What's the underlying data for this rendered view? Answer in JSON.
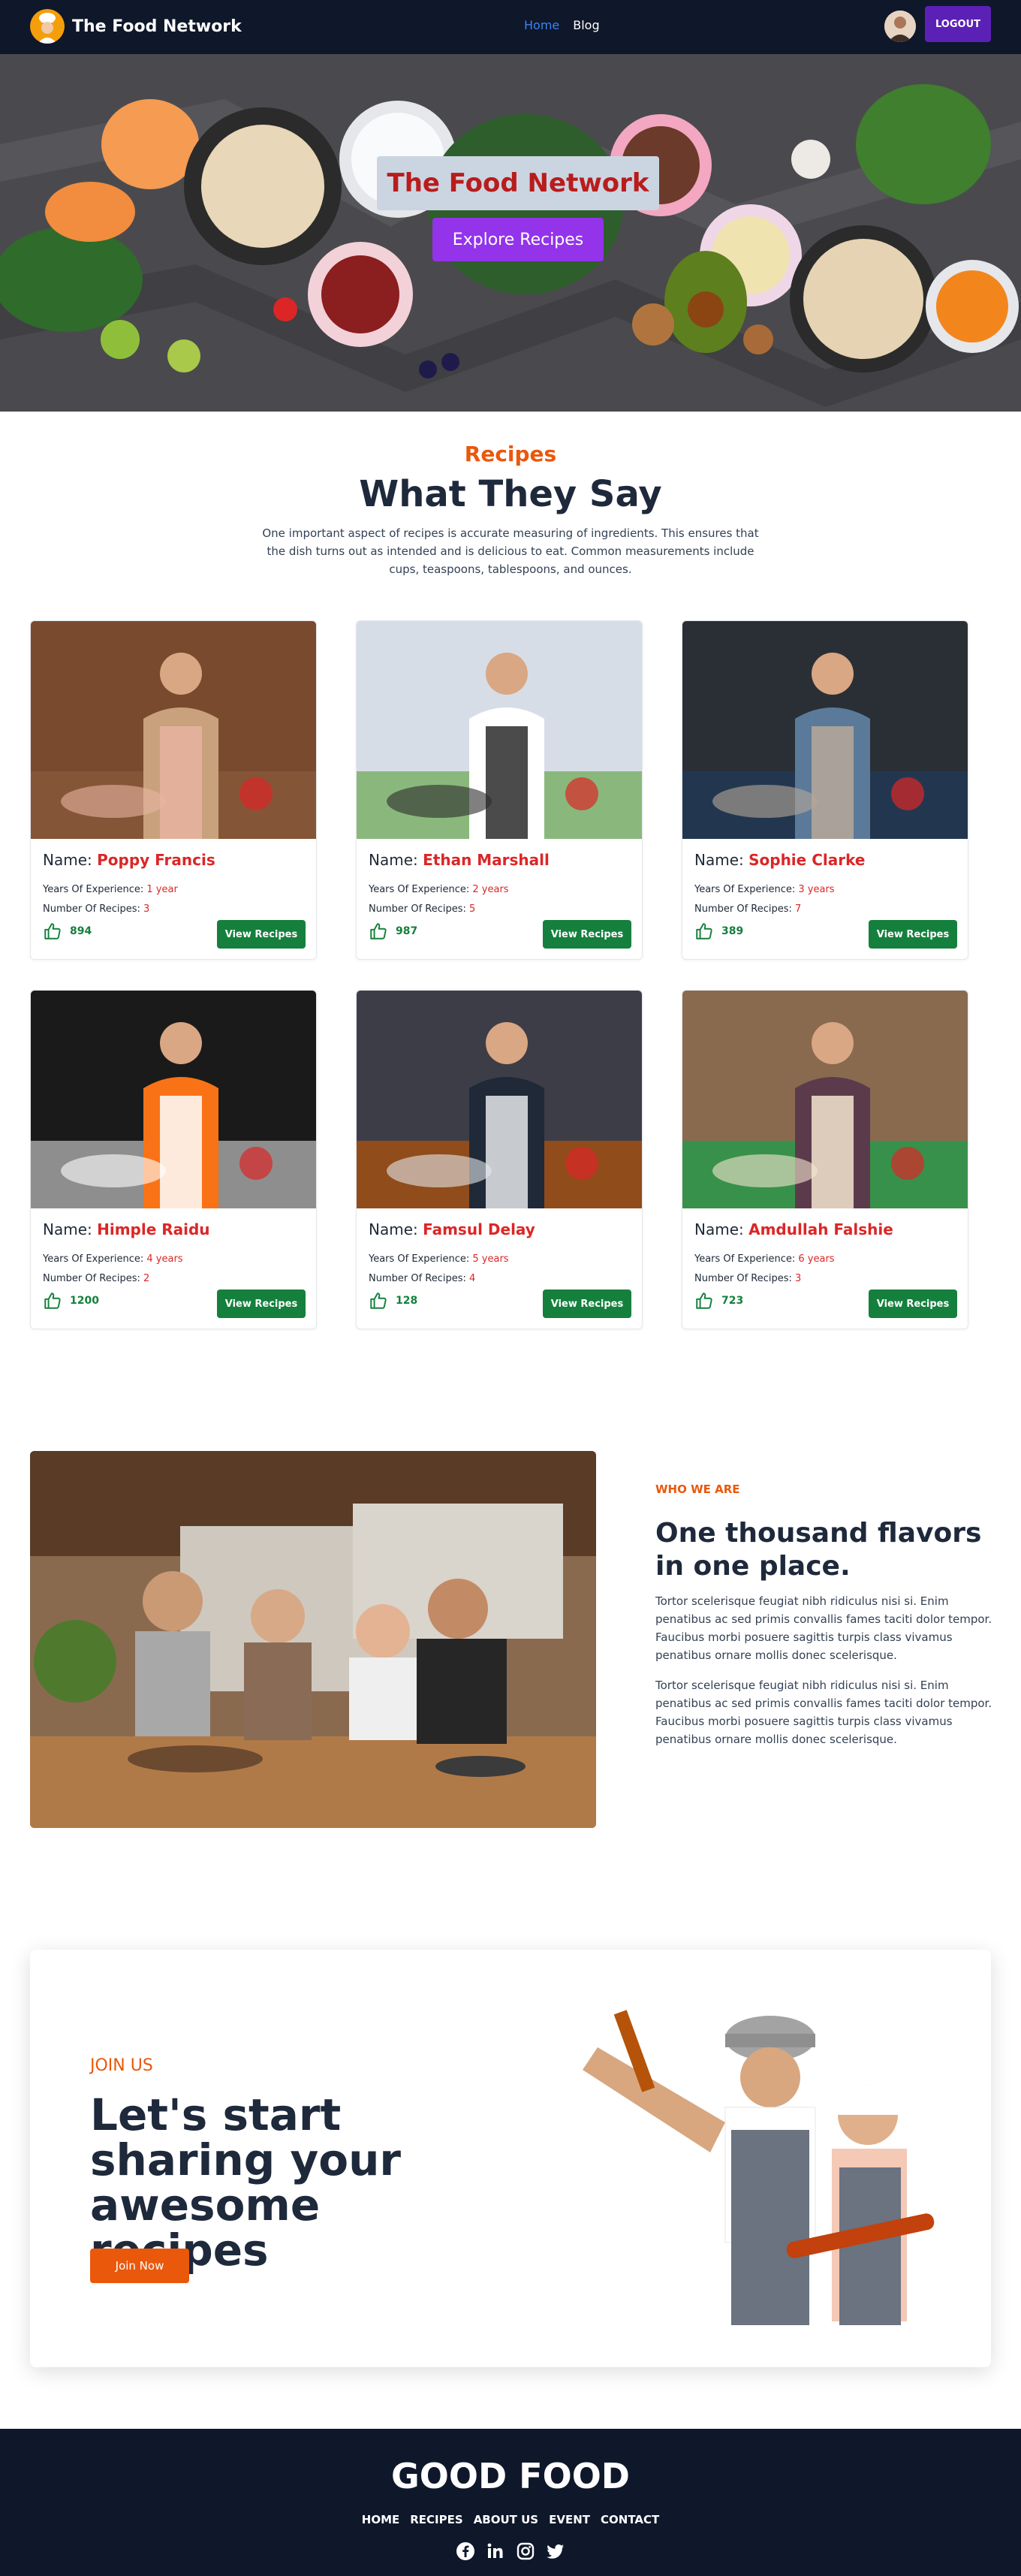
{
  "nav": {
    "brand": "The Food Network",
    "links": [
      {
        "label": "Home",
        "active": true
      },
      {
        "label": "Blog",
        "active": false
      }
    ],
    "logout_label": "LOGOUT"
  },
  "hero": {
    "title": "The Food Network",
    "button_label": "Explore Recipes"
  },
  "recipes_section": {
    "eyebrow": "Recipes",
    "title": "What They Say",
    "description": "One important aspect of recipes is accurate measuring of ingredients. This ensures that the dish turns out as intended and is delicious to eat. Common measurements include cups, teaspoons, tablespoons, and ounces."
  },
  "card_labels": {
    "name": "Name:",
    "experience": "Years Of Experience:",
    "recipes": "Number Of Recipes:",
    "view_button": "View Recipes"
  },
  "chefs": [
    {
      "name": "Poppy Francis",
      "experience": "1 year",
      "recipes": "3",
      "likes": "894"
    },
    {
      "name": "Ethan Marshall",
      "experience": "2 years",
      "recipes": "5",
      "likes": "987"
    },
    {
      "name": "Sophie Clarke",
      "experience": "3 years",
      "recipes": "7",
      "likes": "389"
    },
    {
      "name": "Himple Raidu",
      "experience": "4 years",
      "recipes": "2",
      "likes": "1200"
    },
    {
      "name": "Famsul Delay",
      "experience": "5 years",
      "recipes": "4",
      "likes": "128"
    },
    {
      "name": "Amdullah Falshie",
      "experience": "6 years",
      "recipes": "3",
      "likes": "723"
    }
  ],
  "about": {
    "eyebrow": "WHO WE ARE",
    "title": "One thousand flavors in one place.",
    "paragraphs": [
      "Tortor scelerisque feugiat nibh ridiculus nisi si. Enim penatibus ac sed primis convallis fames taciti dolor tempor. Faucibus morbi posuere sagittis turpis class vivamus penatibus ornare mollis donec scelerisque.",
      "Tortor scelerisque feugiat nibh ridiculus nisi si. Enim penatibus ac sed primis convallis fames taciti dolor tempor. Faucibus morbi posuere sagittis turpis class vivamus penatibus ornare mollis donec scelerisque."
    ]
  },
  "join": {
    "eyebrow": "JOIN US",
    "title": "Let's start sharing your awesome recipes",
    "button_label": "Join Now"
  },
  "footer": {
    "title": "GOOD FOOD",
    "links": [
      "HOME",
      "RECIPES",
      "ABOUT US",
      "EVENT",
      "CONTACT"
    ],
    "socials": [
      "facebook-icon",
      "linkedin-icon",
      "instagram-icon",
      "twitter-icon"
    ]
  },
  "colors": {
    "nav_bg": "#0f172a",
    "accent_orange": "#ea580c",
    "accent_red": "#dc2626",
    "accent_green": "#15803d",
    "hero_button": "#9333ea",
    "logout_button": "#5b21b6"
  }
}
